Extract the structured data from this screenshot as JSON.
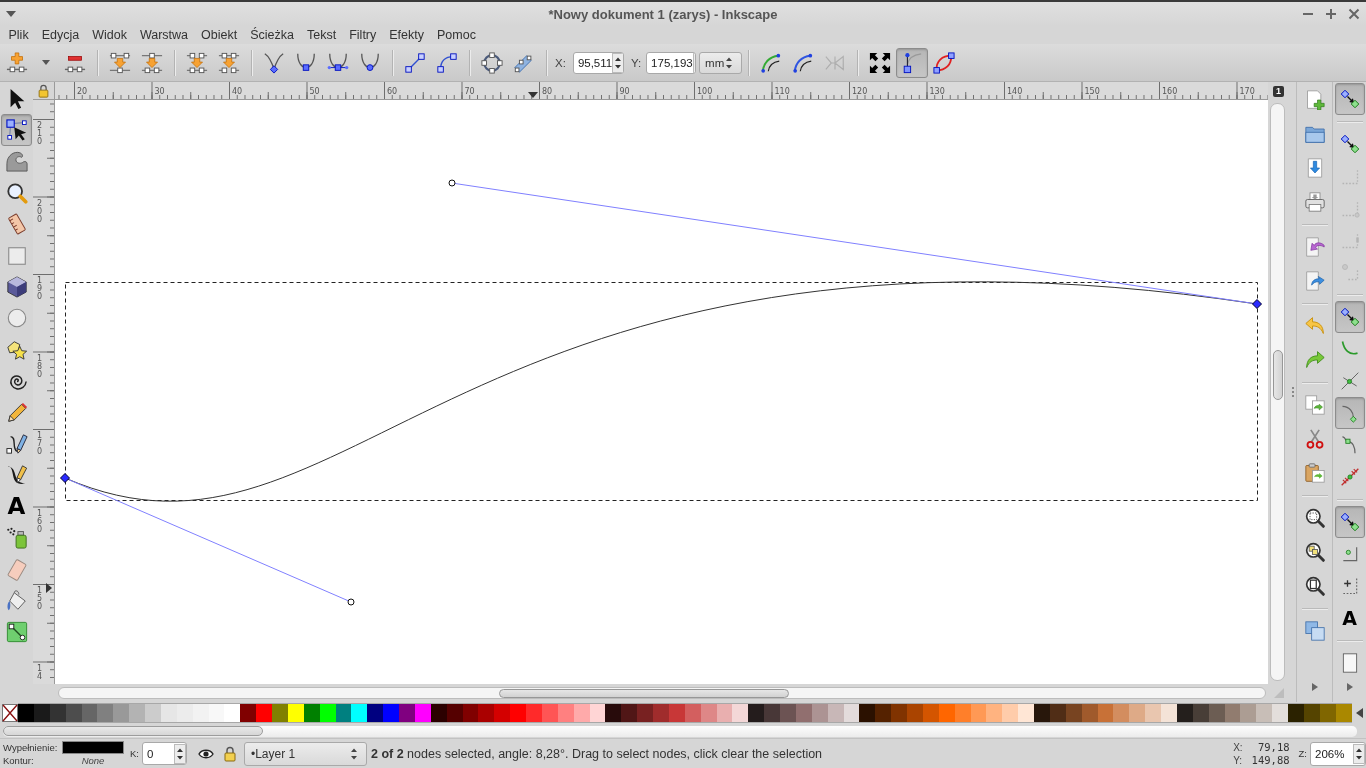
{
  "window": {
    "title": "*Nowy dokument 1 (zarys) - Inkscape"
  },
  "menu": [
    "Plik",
    "Edycja",
    "Widok",
    "Warstwa",
    "Obiekt",
    "Ścieżka",
    "Tekst",
    "Filtry",
    "Efekty",
    "Pomoc"
  ],
  "node_toolbar": {
    "x_label": "X:",
    "x_value": "95,511",
    "y_label": "Y:",
    "y_value": "175,193",
    "unit": "mm",
    "effect_buttons": [
      {
        "disabled": false
      },
      {
        "disabled": false
      },
      {
        "disabled": true
      }
    ],
    "view_toggles": [
      {
        "on": false
      },
      {
        "on": true
      },
      {
        "on": false
      }
    ]
  },
  "tools": [
    {
      "selected": false
    },
    {
      "selected": true
    },
    {
      "selected": false
    },
    {
      "selected": false
    },
    {
      "selected": false
    },
    {
      "selected": false
    },
    {
      "selected": false
    },
    {
      "selected": false
    },
    {
      "selected": false
    },
    {
      "selected": false
    },
    {
      "selected": false
    },
    {
      "selected": false
    },
    {
      "selected": false
    },
    {
      "selected": false,
      "glyph": "A"
    },
    {
      "selected": false
    },
    {
      "selected": false
    },
    {
      "selected": false
    },
    {
      "selected": false
    }
  ],
  "rulers": {
    "horizontal": [
      "20",
      "30",
      "40",
      "50",
      "60",
      "70",
      "80",
      "90",
      "100",
      "110",
      "120",
      "130",
      "140",
      "150",
      "160",
      "170"
    ],
    "vertical": [
      "210",
      "200",
      "190",
      "180",
      "170",
      "160",
      "150",
      "14"
    ]
  },
  "page_badge": "1",
  "snap_bar": [
    {
      "on": true,
      "disabled": false
    },
    {
      "on": false,
      "disabled": false
    },
    {
      "on": false,
      "disabled": true
    },
    {
      "on": false,
      "disabled": true
    },
    {
      "on": false,
      "disabled": true
    },
    {
      "on": false,
      "disabled": true
    },
    {
      "on": true,
      "disabled": false
    },
    {
      "on": false,
      "disabled": false
    },
    {
      "on": false,
      "disabled": false
    },
    {
      "on": true,
      "disabled": false
    },
    {
      "on": false,
      "disabled": false
    },
    {
      "on": false,
      "disabled": false
    },
    {
      "on": true,
      "disabled": false
    },
    {
      "on": false,
      "disabled": false
    },
    {
      "on": false,
      "disabled": false
    },
    {
      "on": false,
      "disabled": false,
      "glyph": "A"
    },
    {
      "on": false,
      "disabled": false
    }
  ],
  "palette": {
    "swatches": [
      {
        "color": "#000000"
      },
      {
        "color": "#1a1a1a"
      },
      {
        "color": "#333333"
      },
      {
        "color": "#4d4d4d"
      },
      {
        "color": "#666666"
      },
      {
        "color": "#808080"
      },
      {
        "color": "#999999"
      },
      {
        "color": "#b3b3b3"
      },
      {
        "color": "#cccccc"
      },
      {
        "color": "#e6e6e6"
      },
      {
        "color": "#ececec"
      },
      {
        "color": "#f2f2f2"
      },
      {
        "color": "#f8f8f8"
      },
      {
        "color": "#ffffff"
      },
      {
        "color": "#800000"
      },
      {
        "color": "#ff0000"
      },
      {
        "color": "#808000"
      },
      {
        "color": "#ffff00"
      },
      {
        "color": "#008000"
      },
      {
        "color": "#00ff00"
      },
      {
        "color": "#008080"
      },
      {
        "color": "#00ffff"
      },
      {
        "color": "#000080"
      },
      {
        "color": "#0000ff"
      },
      {
        "color": "#800080"
      },
      {
        "color": "#ff00ff"
      },
      {
        "color": "#2b0000"
      },
      {
        "color": "#550000"
      },
      {
        "color": "#800000"
      },
      {
        "color": "#aa0000"
      },
      {
        "color": "#d40000"
      },
      {
        "color": "#ff0000"
      },
      {
        "color": "#ff2a2a"
      },
      {
        "color": "#ff5555"
      },
      {
        "color": "#ff8080"
      },
      {
        "color": "#ffaaaa"
      },
      {
        "color": "#ffd5d5"
      },
      {
        "color": "#280b0b"
      },
      {
        "color": "#501616"
      },
      {
        "color": "#782121"
      },
      {
        "color": "#a02c2c"
      },
      {
        "color": "#c83737"
      },
      {
        "color": "#d35f5f"
      },
      {
        "color": "#de8787"
      },
      {
        "color": "#e9afaf"
      },
      {
        "color": "#f4d7d7"
      },
      {
        "color": "#241c1c"
      },
      {
        "color": "#483737"
      },
      {
        "color": "#6c5353"
      },
      {
        "color": "#916f6f"
      },
      {
        "color": "#ac9393"
      },
      {
        "color": "#c8b7b7"
      },
      {
        "color": "#e3dbdb"
      },
      {
        "color": "#2b1100"
      },
      {
        "color": "#552200"
      },
      {
        "color": "#803300"
      },
      {
        "color": "#aa4400"
      },
      {
        "color": "#d45500"
      },
      {
        "color": "#ff6600"
      },
      {
        "color": "#ff7f2a"
      },
      {
        "color": "#ff9955"
      },
      {
        "color": "#ffb380"
      },
      {
        "color": "#ffccaa"
      },
      {
        "color": "#ffe6d5"
      },
      {
        "color": "#28170b"
      },
      {
        "color": "#502d16"
      },
      {
        "color": "#784421"
      },
      {
        "color": "#a05a2c"
      },
      {
        "color": "#c87137"
      },
      {
        "color": "#d38d5f"
      },
      {
        "color": "#deaa87"
      },
      {
        "color": "#e9c6af"
      },
      {
        "color": "#f4e3d7"
      },
      {
        "color": "#241f1c"
      },
      {
        "color": "#483e37"
      },
      {
        "color": "#6c5d53"
      },
      {
        "color": "#917c6f"
      },
      {
        "color": "#ac9d93"
      },
      {
        "color": "#c8beb7"
      },
      {
        "color": "#e3dedb"
      },
      {
        "color": "#2b2200"
      },
      {
        "color": "#554400"
      },
      {
        "color": "#806600"
      },
      {
        "color": "#aa8800"
      }
    ]
  },
  "status_bar": {
    "fill": {
      "label": "Wypełnienie:",
      "color": "#000000"
    },
    "stroke": {
      "label": "Kontur:",
      "value": "None"
    },
    "opacity": {
      "label": "K:",
      "value": "0"
    },
    "layer": "•Layer 1",
    "message": "**2 of 2** nodes selected, angle: 8,28°. Drag to select nodes, click clear the selection",
    "cursor": {
      "x_label": "X:",
      "x_value": "79,18",
      "y_label": "Y:",
      "y_value": "149,88"
    },
    "zoom": {
      "label": "Z:",
      "value": "206%"
    }
  }
}
